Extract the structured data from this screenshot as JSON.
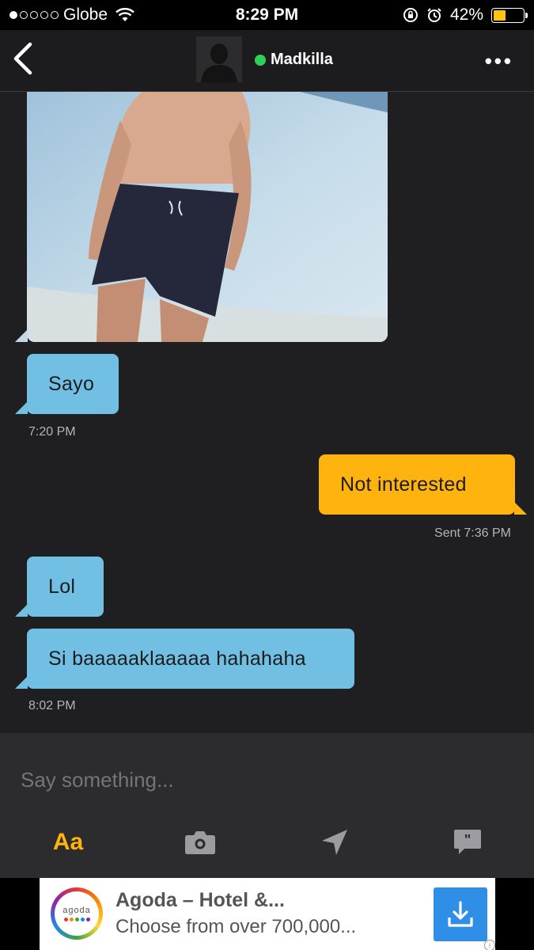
{
  "status_bar": {
    "carrier": "Globe",
    "time": "8:29 PM",
    "battery_percent": "42%",
    "battery_level": 0.42,
    "signal_bars_filled": 1,
    "signal_bars_total": 5
  },
  "nav": {
    "contact_name": "Madkilla",
    "online": true,
    "more_label": "•••"
  },
  "messages": [
    {
      "id": "m1",
      "direction": "incoming",
      "type": "photo"
    },
    {
      "id": "m2",
      "direction": "incoming",
      "text": "Sayo",
      "time": "7:20 PM"
    },
    {
      "id": "m3",
      "direction": "outgoing",
      "text": "Not interested",
      "time": "Sent 7:36 PM"
    },
    {
      "id": "m4",
      "direction": "incoming",
      "text": "Lol"
    },
    {
      "id": "m5",
      "direction": "incoming",
      "text": "Si baaaaaklaaaaa hahahaha",
      "time": "8:02 PM"
    }
  ],
  "composer": {
    "placeholder": "Say something...",
    "text_tool_label": "Aa",
    "tools": [
      "text-format-icon",
      "camera-icon",
      "location-arrow-icon",
      "saved-phrases-icon"
    ]
  },
  "ad": {
    "logo_text": "agoda",
    "title": "Agoda – Hotel &...",
    "subtitle": "Choose from over 700,000...",
    "info": "i"
  },
  "colors": {
    "incoming_bubble": "#71bfe2",
    "outgoing_bubble": "#ffb30e",
    "accent": "#ffb30e",
    "online": "#2ed158",
    "chat_bg": "#1f1f21"
  }
}
